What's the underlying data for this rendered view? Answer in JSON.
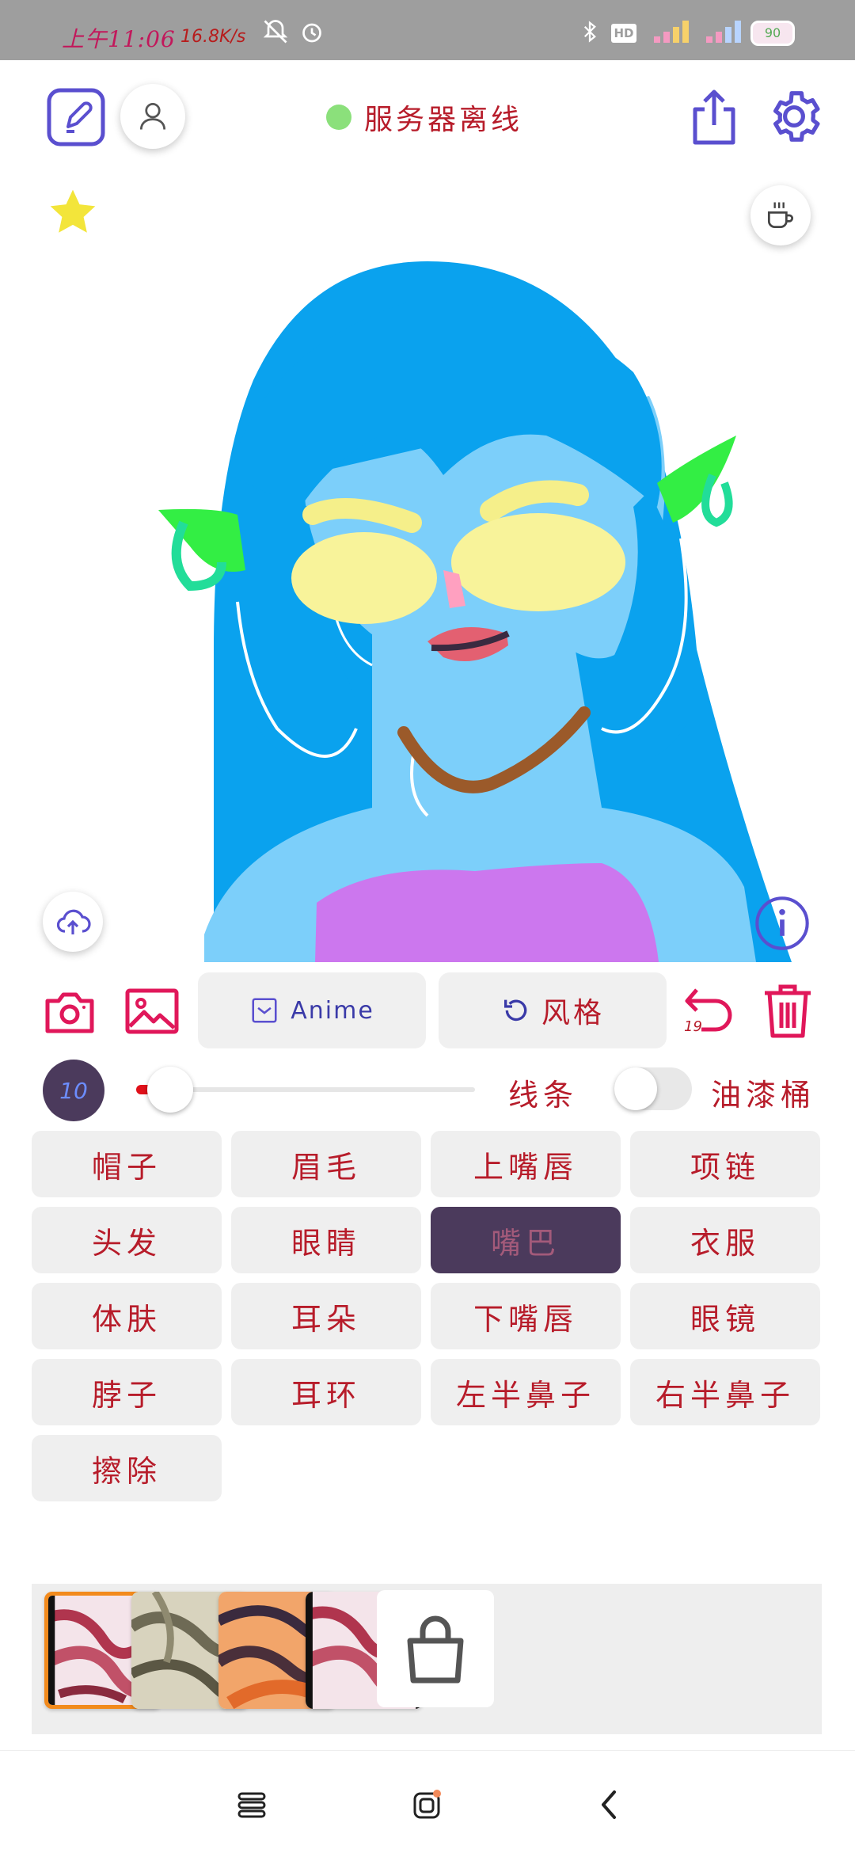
{
  "status_bar": {
    "time": "上午11:06",
    "net_speed": "16.8K/s",
    "icons": [
      "bell-off-icon",
      "alarm-icon",
      "bluetooth-icon",
      "hd-icon",
      "signal-icon",
      "signal-icon",
      "battery-icon"
    ],
    "battery_level": "90"
  },
  "header": {
    "server_status": "服务器离线",
    "server_status_color": "#8be07b",
    "left_icons": [
      "edit-icon",
      "user-icon"
    ],
    "right_icons": [
      "share-icon",
      "gear-icon"
    ]
  },
  "canvas": {
    "favorite_icon": "star-icon",
    "coffee_icon": "coffee-icon",
    "upload_icon": "cloud-upload-icon",
    "info_icon": "info-icon"
  },
  "toolbar": {
    "camera_icon": "camera-icon",
    "gallery_icon": "image-icon",
    "anime_label": "Anime",
    "style_label": "风格",
    "undo_count": "19",
    "delete_icon": "trash-icon"
  },
  "brush": {
    "size": "10",
    "slider_fraction": 0.1,
    "line_label": "线条",
    "bucket_label": "油漆桶",
    "bucket_on": false
  },
  "parts": [
    {
      "label": "帽子"
    },
    {
      "label": "眉毛"
    },
    {
      "label": "上嘴唇"
    },
    {
      "label": "项链"
    },
    {
      "label": "头发"
    },
    {
      "label": "眼睛"
    },
    {
      "label": "嘴巴",
      "active": true
    },
    {
      "label": "衣服"
    },
    {
      "label": "体肤"
    },
    {
      "label": "耳朵"
    },
    {
      "label": "下嘴唇"
    },
    {
      "label": "眼镜"
    },
    {
      "label": "脖子"
    },
    {
      "label": "耳环"
    },
    {
      "label": "左半鼻子"
    },
    {
      "label": "右半鼻子"
    },
    {
      "label": "擦除"
    }
  ],
  "textures": [
    {
      "name": "texture-1",
      "selected": true
    },
    {
      "name": "texture-2",
      "selected": false
    },
    {
      "name": "texture-3",
      "selected": false
    },
    {
      "name": "texture-4",
      "selected": false
    }
  ],
  "tray_lock_icon": "lock-icon",
  "nav": [
    "menu-icon",
    "home-icon",
    "back-icon"
  ],
  "colors": {
    "accent_red": "#e0175a",
    "accent_blue": "#5a4fcf",
    "active_part": "#4b3a5c",
    "hair": "#0aa2ee",
    "skin": "#7ccffa"
  }
}
